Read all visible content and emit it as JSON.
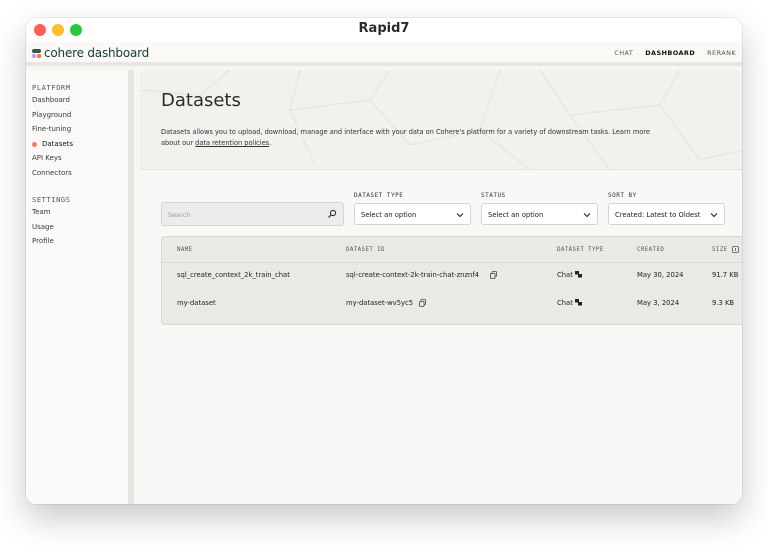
{
  "window": {
    "title": "Rapid7"
  },
  "app": {
    "logo_text": "cohere dashboard",
    "nav": [
      {
        "label": "CHAT"
      },
      {
        "label": "DASHBOARD",
        "active": true
      },
      {
        "label": "RERANK"
      }
    ]
  },
  "sidebar": {
    "platform_heading": "PLATFORM",
    "platform_items": [
      {
        "label": "Dashboard"
      },
      {
        "label": "Playground"
      },
      {
        "label": "Fine-tuning"
      },
      {
        "label": "Datasets",
        "active": true
      },
      {
        "label": "API Keys"
      },
      {
        "label": "Connectors"
      }
    ],
    "settings_heading": "SETTINGS",
    "settings_items": [
      {
        "label": "Team"
      },
      {
        "label": "Usage"
      },
      {
        "label": "Profile"
      }
    ]
  },
  "page": {
    "title": "Datasets",
    "description_part1": "Datasets allows you to upload, download, manage and interface with your data on Cohere's platform for a variety of downstream tasks. Learn more about our ",
    "description_link": "data retention policies",
    "description_end": "."
  },
  "filters": {
    "search_placeholder": "Search",
    "dataset_type": {
      "label": "DATASET TYPE",
      "value": "Select an option"
    },
    "status": {
      "label": "STATUS",
      "value": "Select an option"
    },
    "sort_by": {
      "label": "SORT BY",
      "value": "Created: Latest to Oldest"
    }
  },
  "table": {
    "columns": [
      "NAME",
      "DATASET ID",
      "DATASET TYPE",
      "CREATED",
      "SIZE"
    ],
    "rows": [
      {
        "name": "sql_create_context_2k_train_chat",
        "dataset_id": "sql-create-context-2k-train-chat-znznf4",
        "type": "Chat",
        "created": "May 30, 2024",
        "size": "91.7 KB"
      },
      {
        "name": "my-dataset",
        "dataset_id": "my-dataset-wv5yc5",
        "type": "Chat",
        "created": "May 3, 2024",
        "size": "9.3 KB"
      }
    ]
  },
  "colors": {
    "accent": "#ff7759",
    "brand": "#39594d",
    "background": "#f7f6f3"
  },
  "icons": {
    "search": "search-icon",
    "chevron": "chevron-down-icon",
    "copy": "copy-icon",
    "chat": "chat-icon",
    "info": "info-icon"
  }
}
